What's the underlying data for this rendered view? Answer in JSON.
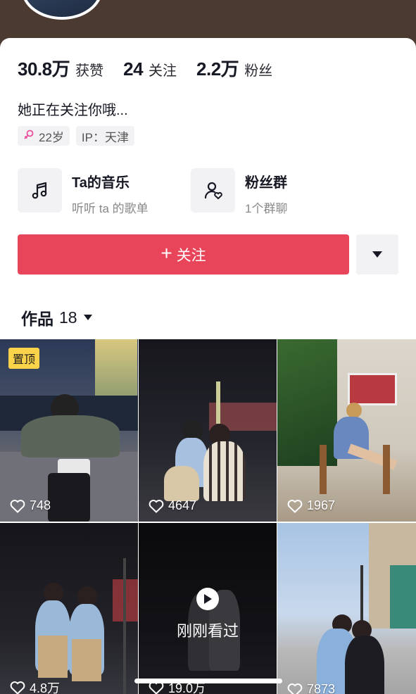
{
  "profile": {
    "stats": [
      {
        "value": "30.8万",
        "label": "获赞"
      },
      {
        "value": "24",
        "label": "关注"
      },
      {
        "value": "2.2万",
        "label": "粉丝"
      }
    ],
    "bio": "她正在关注你哦...",
    "tags": {
      "age": "22岁",
      "ip": "IP：天津"
    },
    "features": [
      {
        "title": "Ta的音乐",
        "subtitle": "听听 ta 的歌单",
        "icon": "music-note-icon"
      },
      {
        "title": "粉丝群",
        "subtitle": "1个群聊",
        "icon": "fan-group-icon"
      }
    ],
    "follow_label": "关注",
    "follow_color": "#e8455a"
  },
  "works": {
    "label": "作品",
    "count": "18",
    "items": [
      {
        "likes": "748",
        "pinned": true,
        "pin_label": "置顶",
        "bg": "#5a6070"
      },
      {
        "likes": "4647",
        "bg": "#202028"
      },
      {
        "likes": "1967",
        "bg": "#c8c2b8"
      },
      {
        "likes": "4.8万",
        "bg": "#252530"
      },
      {
        "likes": "19.0万",
        "seen": true,
        "seen_label": "刚刚看过",
        "bg": "#1a1a22"
      },
      {
        "likes": "7873",
        "bg": "#9db5d0"
      }
    ]
  }
}
